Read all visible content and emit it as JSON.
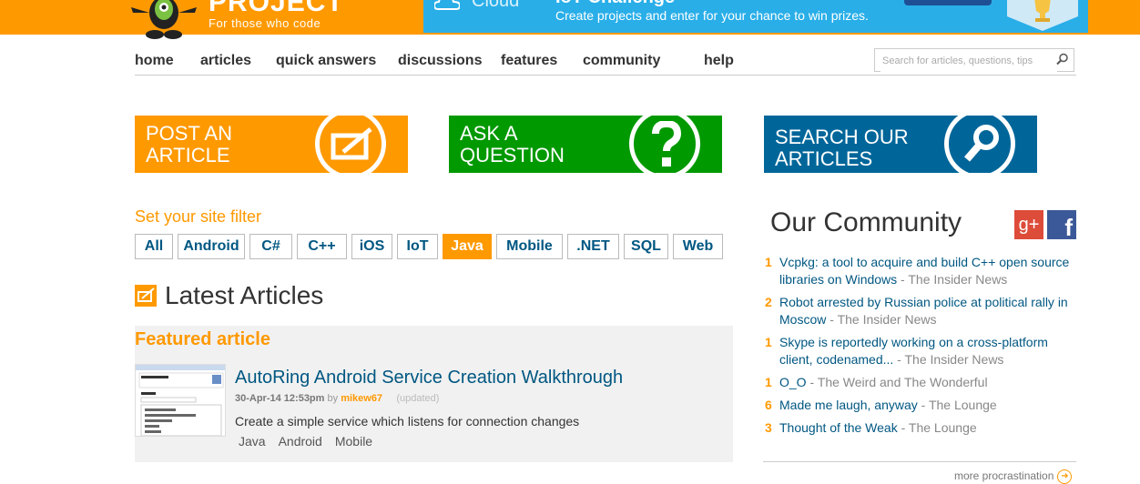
{
  "header": {
    "logo_text": "PROJECT",
    "tagline": "For those who code",
    "banner": {
      "cloud_text": "Cloud",
      "title": "IoT Challenge",
      "subtitle": "Create projects and enter for your chance to win prizes."
    }
  },
  "nav": {
    "items": [
      "home",
      "articles",
      "quick answers",
      "discussions",
      "features",
      "community",
      "help"
    ],
    "search_placeholder": "Search for articles, questions, tips"
  },
  "cta": {
    "post": "POST AN ARTICLE",
    "ask": "ASK A QUESTION",
    "search": "SEARCH OUR ARTICLES"
  },
  "filter": {
    "title": "Set your site filter",
    "chips": [
      "All",
      "Android",
      "C#",
      "C++",
      "iOS",
      "IoT",
      "Java",
      "Mobile",
      ".NET",
      "SQL",
      "Web"
    ],
    "active": "Java"
  },
  "latest": {
    "title": "Latest Articles",
    "featured_label": "Featured article",
    "article": {
      "title": "AutoRing Android Service Creation Walkthrough",
      "date": "30-Apr-14 12:53pm",
      "by": "by",
      "author": "mikew67",
      "updated": "(updated)",
      "description": "Create a simple service which listens for connection changes",
      "tags": [
        "Java",
        "Android",
        "Mobile"
      ]
    }
  },
  "community": {
    "title": "Our Community",
    "gplus": "g+",
    "fb": "f",
    "items": [
      {
        "num": "1",
        "text": "Vcpkg: a tool to acquire and build C++ open source libraries on Windows",
        "sep": " - ",
        "source": "The Insider News"
      },
      {
        "num": "2",
        "text": "Robot arrested by Russian police at political rally in Moscow",
        "sep": " - ",
        "source": "The Insider News"
      },
      {
        "num": "1",
        "text": "Skype is reportedly working on a cross-platform client, codenamed...",
        "sep": " - ",
        "source": "The Insider News"
      },
      {
        "num": "1",
        "text": "O_O",
        "sep": " - ",
        "source": "The Weird and The Wonderful"
      },
      {
        "num": "6",
        "text": "Made me laugh, anyway",
        "sep": " - ",
        "source": "The Lounge"
      },
      {
        "num": "3",
        "text": "Thought of the Weak",
        "sep": " - ",
        "source": "The Lounge"
      }
    ],
    "more": "more procrastination"
  },
  "colors": {
    "orange": "#ff9900",
    "green": "#009900",
    "blue": "#00669a",
    "link": "#005782"
  }
}
